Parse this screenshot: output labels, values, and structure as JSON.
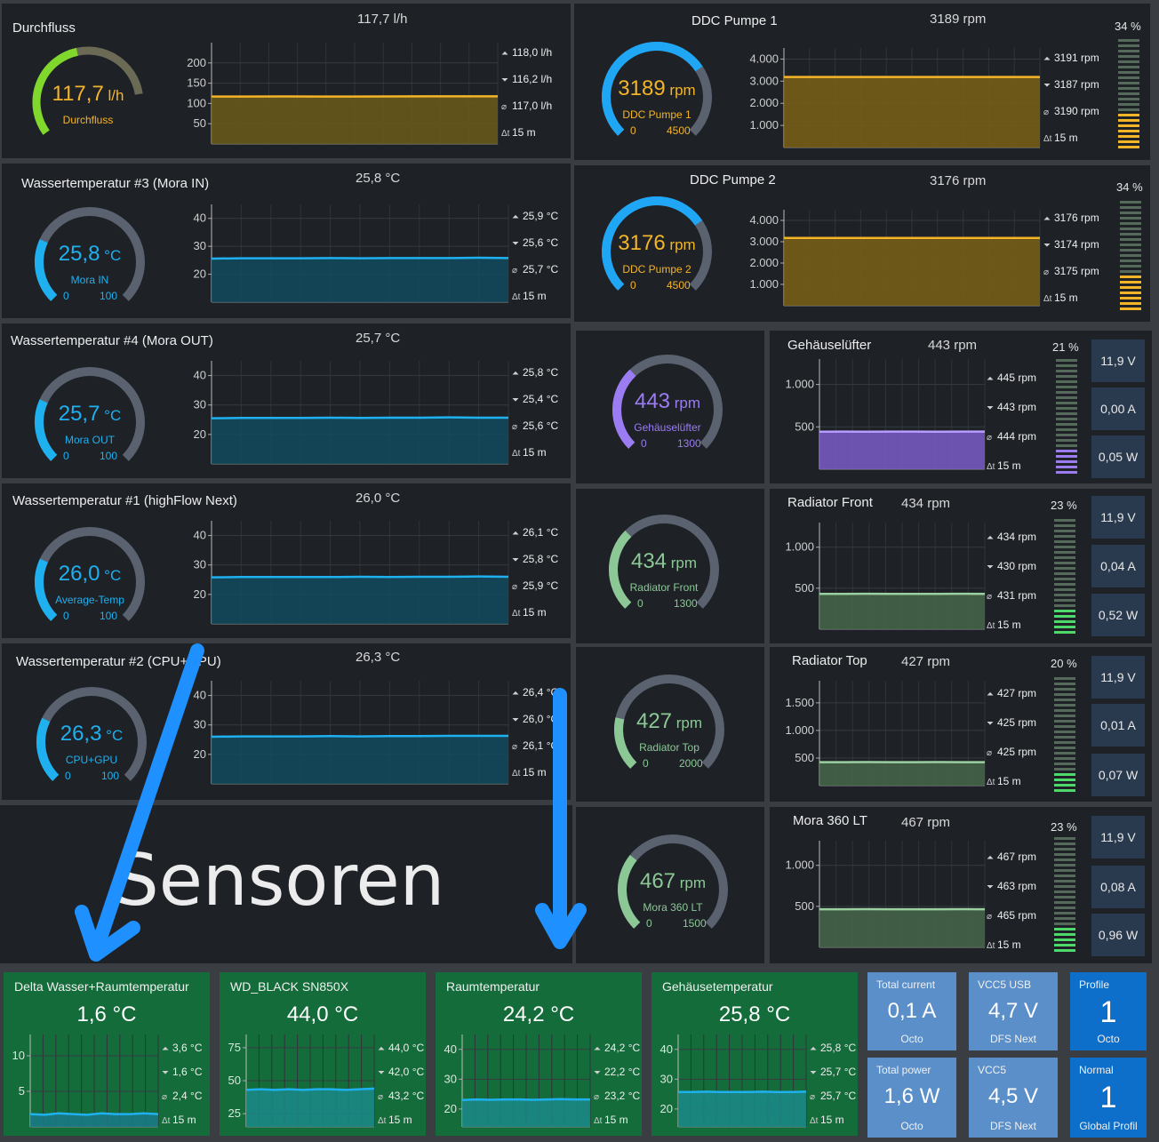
{
  "colors": {
    "panel": "#1e2227",
    "grid": "#3a3f46",
    "blue": "#1fb0f0",
    "orange": "#f4b428",
    "purple": "#9b7cf2",
    "green": "#8cc896",
    "lime": "#7fd82b",
    "gauge_track": "#5a6270",
    "tile_green": "#146c3a",
    "tile_blue_light": "#5b8fc9",
    "tile_blue": "#0d6fc9",
    "bar_off": "#5a6a5e",
    "bar_on_orange": "#f4b428",
    "bar_on_purple": "#9b7cf2",
    "bar_on_green": "#4ed96b",
    "arrow": "#1e90ff"
  },
  "flow": {
    "title": "Durchfluss",
    "value": "117,7 l/h",
    "gauge_value": "117,7",
    "gauge_unit": "l/h",
    "gauge_label": "Durchfluss",
    "max": "118,0 l/h",
    "min": "116,2 l/h",
    "avg": "117,0 l/h",
    "span": "15 m",
    "chart_data": {
      "type": "area",
      "ylabels": [
        "200",
        "150",
        "100",
        "50"
      ],
      "ylim": [
        0,
        250
      ],
      "values": [
        117,
        117,
        117.2,
        117.1,
        117,
        117.3,
        117.5,
        117.6,
        117.7
      ],
      "color": "#f4b428",
      "fill": "#6b5a1a"
    },
    "gauge_fraction": 0.55
  },
  "temp3": {
    "title": "Wassertemperatur #3 (Mora IN)",
    "value": "25,8 °C",
    "gauge_value": "25,8",
    "gauge_unit": "°C",
    "gauge_label": "Mora IN",
    "gmin": "0",
    "gmax": "100",
    "max": "25,9 °C",
    "min": "25,6 °C",
    "avg": "25,7 °C",
    "span": "15 m",
    "chart_data": {
      "type": "area",
      "ylabels": [
        "40",
        "30",
        "20"
      ],
      "ylim": [
        10,
        45
      ],
      "values": [
        25.6,
        25.7,
        25.7,
        25.7,
        25.8,
        25.7,
        25.8,
        25.8,
        25.8,
        25.9,
        25.8
      ],
      "color": "#1fb0f0",
      "fill": "#124a5e"
    },
    "gauge_fraction": 0.258
  },
  "temp4": {
    "title": "Wassertemperatur #4 (Mora OUT)",
    "value": "25,7 °C",
    "gauge_value": "25,7",
    "gauge_unit": "°C",
    "gauge_label": "Mora OUT",
    "gmin": "0",
    "gmax": "100",
    "max": "25,8 °C",
    "min": "25,4 °C",
    "avg": "25,6 °C",
    "span": "15 m",
    "chart_data": {
      "type": "area",
      "ylabels": [
        "40",
        "30",
        "20"
      ],
      "ylim": [
        10,
        45
      ],
      "values": [
        25.5,
        25.6,
        25.6,
        25.6,
        25.7,
        25.6,
        25.7,
        25.7,
        25.8,
        25.7,
        25.7
      ],
      "color": "#1fb0f0",
      "fill": "#124a5e"
    },
    "gauge_fraction": 0.257
  },
  "temp1": {
    "title": "Wassertemperatur #1 (highFlow Next)",
    "value": "26,0 °C",
    "gauge_value": "26,0",
    "gauge_unit": "°C",
    "gauge_label": "Average-Temp",
    "gmin": "0",
    "gmax": "100",
    "max": "26,1 °C",
    "min": "25,8 °C",
    "avg": "25,9 °C",
    "span": "15 m",
    "chart_data": {
      "type": "area",
      "ylabels": [
        "40",
        "30",
        "20"
      ],
      "ylim": [
        10,
        45
      ],
      "values": [
        25.8,
        25.9,
        25.9,
        25.9,
        25.9,
        26.0,
        25.9,
        26.0,
        26.0,
        26.1,
        26.0
      ],
      "color": "#1fb0f0",
      "fill": "#124a5e"
    },
    "gauge_fraction": 0.26
  },
  "temp2": {
    "title": "Wassertemperatur #2 (CPU+GPU)",
    "value": "26,3 °C",
    "gauge_value": "26,3",
    "gauge_unit": "°C",
    "gauge_label": "CPU+GPU",
    "gmin": "0",
    "gmax": "100",
    "max": "26,4 °C",
    "min": "26,0 °C",
    "avg": "26,1 °C",
    "span": "15 m",
    "chart_data": {
      "type": "area",
      "ylabels": [
        "40",
        "30",
        "20"
      ],
      "ylim": [
        10,
        45
      ],
      "values": [
        26.0,
        26.1,
        26.1,
        26.1,
        26.2,
        26.1,
        26.2,
        26.2,
        26.3,
        26.3,
        26.3
      ],
      "color": "#1fb0f0",
      "fill": "#124a5e"
    },
    "gauge_fraction": 0.263
  },
  "pump1": {
    "title": "DDC Pumpe 1",
    "value": "3189 rpm",
    "gauge_value": "3189",
    "gauge_unit": "rpm",
    "gauge_label": "DDC Pumpe 1",
    "gmin": "0",
    "gmax": "4500",
    "max": "3191 rpm",
    "min": "3187 rpm",
    "avg": "3190 rpm",
    "span": "15 m",
    "pct": "34 %",
    "pct_value": 0.34,
    "chart_data": {
      "type": "area",
      "ylabels": [
        "4.000",
        "3.000",
        "2.000",
        "1.000"
      ],
      "ylim": [
        0,
        4500
      ],
      "values": [
        3189,
        3189,
        3190,
        3189,
        3189,
        3190,
        3189,
        3189
      ],
      "color": "#f4b428",
      "fill": "#7a5f16"
    },
    "gauge_fraction": 0.709
  },
  "pump2": {
    "title": "DDC Pumpe 2",
    "value": "3176 rpm",
    "gauge_value": "3176",
    "gauge_unit": "rpm",
    "gauge_label": "DDC Pumpe 2",
    "gmin": "0",
    "gmax": "4500",
    "max": "3176 rpm",
    "min": "3174 rpm",
    "avg": "3175 rpm",
    "span": "15 m",
    "pct": "34 %",
    "pct_value": 0.34,
    "chart_data": {
      "type": "area",
      "ylabels": [
        "4.000",
        "3.000",
        "2.000",
        "1.000"
      ],
      "ylim": [
        0,
        4500
      ],
      "values": [
        3175,
        3175,
        3176,
        3175,
        3175,
        3176,
        3175,
        3176
      ],
      "color": "#f4b428",
      "fill": "#7a5f16"
    },
    "gauge_fraction": 0.706
  },
  "fan1": {
    "title": "Gehäuselüfter",
    "value": "443 rpm",
    "gauge_value": "443",
    "gauge_unit": "rpm",
    "gauge_label": "Gehäuselüfter",
    "gmin": "0",
    "gmax": "1300",
    "max": "445 rpm",
    "min": "443 rpm",
    "avg": "444 rpm",
    "span": "15 m",
    "pct": "21 %",
    "pct_value": 0.21,
    "volt": "11,9 V",
    "amp": "0,00 A",
    "watt": "0,05 W",
    "chart_data": {
      "type": "area",
      "ylabels": [
        "1.000",
        "500"
      ],
      "ylim": [
        0,
        1300
      ],
      "values": [
        443,
        444,
        443,
        444,
        444,
        443,
        444,
        444
      ],
      "color": "#b89cff",
      "fill": "#7a5cc8"
    },
    "gauge_fraction": 0.34
  },
  "fan2": {
    "title": "Radiator Front",
    "value": "434 rpm",
    "gauge_value": "434",
    "gauge_unit": "rpm",
    "gauge_label": "Radiator Front",
    "gmin": "0",
    "gmax": "1300",
    "max": "434 rpm",
    "min": "430 rpm",
    "avg": "431 rpm",
    "span": "15 m",
    "pct": "23 %",
    "pct_value": 0.23,
    "volt": "11,9 V",
    "amp": "0,04 A",
    "watt": "0,52 W",
    "chart_data": {
      "type": "area",
      "ylabels": [
        "1.000",
        "500"
      ],
      "ylim": [
        0,
        1300
      ],
      "values": [
        431,
        431,
        432,
        431,
        430,
        431,
        432,
        431
      ],
      "color": "#9ad0a0",
      "fill": "#46664a"
    },
    "gauge_fraction": 0.334
  },
  "fan3": {
    "title": "Radiator Top",
    "value": "427 rpm",
    "gauge_value": "427",
    "gauge_unit": "rpm",
    "gauge_label": "Radiator Top",
    "gmin": "0",
    "gmax": "2000",
    "max": "427 rpm",
    "min": "425 rpm",
    "avg": "425 rpm",
    "span": "15 m",
    "pct": "20 %",
    "pct_value": 0.2,
    "volt": "11,9 V",
    "amp": "0,01 A",
    "watt": "0,07 W",
    "chart_data": {
      "type": "area",
      "ylabels": [
        "1.500",
        "1.000",
        "500"
      ],
      "ylim": [
        0,
        1900
      ],
      "values": [
        425,
        425,
        426,
        425,
        425,
        426,
        425,
        425
      ],
      "color": "#9ad0a0",
      "fill": "#46664a"
    },
    "gauge_fraction": 0.214
  },
  "fan4": {
    "title": "Mora 360 LT",
    "value": "467 rpm",
    "gauge_value": "467",
    "gauge_unit": "rpm",
    "gauge_label": "Mora 360 LT",
    "gmin": "0",
    "gmax": "1500",
    "max": "467 rpm",
    "min": "463 rpm",
    "avg": "465 rpm",
    "span": "15 m",
    "pct": "23 %",
    "pct_value": 0.23,
    "volt": "11,9 V",
    "amp": "0,08 A",
    "watt": "0,96 W",
    "chart_data": {
      "type": "area",
      "ylabels": [
        "1.000",
        "500"
      ],
      "ylim": [
        0,
        1300
      ],
      "values": [
        465,
        465,
        466,
        465,
        464,
        465,
        466,
        465
      ],
      "color": "#9ad0a0",
      "fill": "#46664a"
    },
    "gauge_fraction": 0.311
  },
  "sensoren": "Sensoren",
  "tiles": [
    {
      "title": "Delta Wasser+Raumtemperatur",
      "value": "1,6 °C",
      "max": "3,6 °C",
      "min": "1,6 °C",
      "avg": "2,4 °C",
      "span": "15 m",
      "chart_data": {
        "type": "area",
        "ylabels": [
          "10",
          "5"
        ],
        "ylim": [
          0,
          13
        ],
        "values": [
          1.8,
          1.7,
          1.9,
          1.8,
          1.7,
          1.9,
          1.8,
          1.8,
          1.9,
          1.8
        ],
        "color": "#1fb0f0",
        "fill": "#1a7a8a"
      }
    },
    {
      "title": "WD_BLACK SN850X",
      "value": "44,0 °C",
      "max": "44,0 °C",
      "min": "42,0 °C",
      "avg": "43,2 °C",
      "span": "15 m",
      "chart_data": {
        "type": "area",
        "ylabels": [
          "75",
          "50",
          "25"
        ],
        "ylim": [
          15,
          85
        ],
        "values": [
          43,
          43.5,
          43,
          43.5,
          43,
          43.5,
          43.5,
          43,
          43.5,
          44
        ],
        "color": "#1fb0f0",
        "fill": "#1a8a8a"
      }
    },
    {
      "title": "Raumtemperatur",
      "value": "24,2 °C",
      "max": "24,2 °C",
      "min": "22,2 °C",
      "avg": "23,2 °C",
      "span": "15 m",
      "chart_data": {
        "type": "area",
        "ylabels": [
          "40",
          "30",
          "20"
        ],
        "ylim": [
          14,
          45
        ],
        "values": [
          23,
          23.2,
          23.1,
          23.2,
          23.2,
          23.1,
          23.2,
          23.3,
          23.2,
          23.2
        ],
        "color": "#1fb0f0",
        "fill": "#1a8a8a"
      }
    },
    {
      "title": "Gehäusetemperatur",
      "value": "25,8 °C",
      "max": "25,8 °C",
      "min": "25,7 °C",
      "avg": "25,7 °C",
      "span": "15 m",
      "chart_data": {
        "type": "area",
        "ylabels": [
          "40",
          "30",
          "20"
        ],
        "ylim": [
          14,
          45
        ],
        "values": [
          25.7,
          25.7,
          25.8,
          25.7,
          25.7,
          25.7,
          25.8,
          25.7,
          25.7,
          25.8
        ],
        "color": "#1fb0f0",
        "fill": "#1a8a8a"
      }
    }
  ],
  "small": [
    {
      "title": "Total current",
      "value": "0,1 A",
      "sub": "Octo"
    },
    {
      "title": "VCC5 USB",
      "value": "4,7 V",
      "sub": "DFS Next"
    },
    {
      "title": "Profile",
      "value": "1",
      "sub": "Octo"
    },
    {
      "title": "Total power",
      "value": "1,6 W",
      "sub": "Octo"
    },
    {
      "title": "VCC5",
      "value": "4,5 V",
      "sub": "DFS Next"
    },
    {
      "title": "Normal",
      "value": "1",
      "sub": "Global Profil"
    }
  ]
}
